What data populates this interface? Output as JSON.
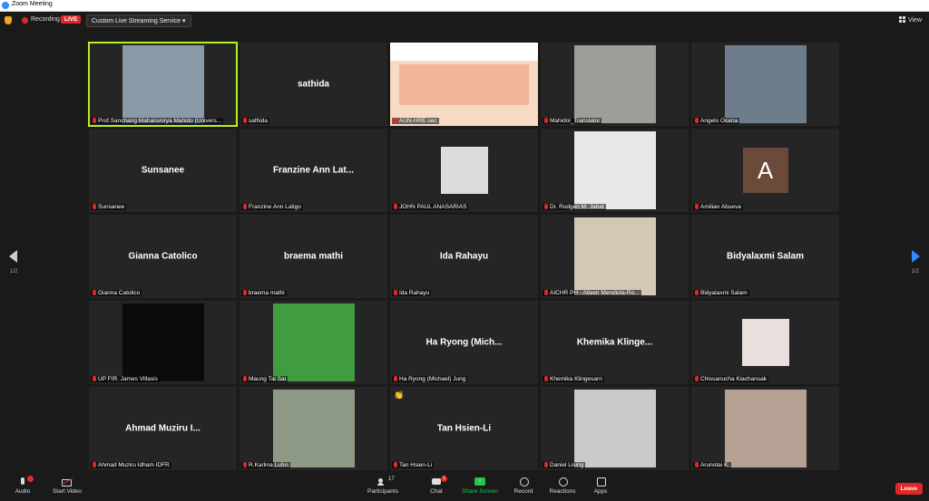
{
  "window": {
    "title": "Zoom Meeting"
  },
  "topbar": {
    "recording": "Recording",
    "live": "LIVE",
    "stream_label": "Custom Live Streaming Service",
    "view": "View"
  },
  "pagination": {
    "left": "1/2",
    "right": "1/2"
  },
  "tiles": [
    {
      "kind": "video",
      "label": "Prof.Sanchang Mahaisvorya Mahido (Univers...",
      "video_color": "#8a9aa8",
      "active": true
    },
    {
      "kind": "name",
      "name": "sathida",
      "label": "sathida"
    },
    {
      "kind": "slide",
      "label": "AUN-HRE.sec"
    },
    {
      "kind": "video",
      "label": "Mahidol_Translator",
      "video_color": "#9c9f98"
    },
    {
      "kind": "video",
      "label": "Angelo Ocena",
      "video_color": "#6d7d8c"
    },
    {
      "kind": "name",
      "name": "Sunsanee",
      "label": "Sunsanee"
    },
    {
      "kind": "name",
      "name": "Franzine Ann Lat...",
      "label": "Franzine Ann Latigo"
    },
    {
      "kind": "video",
      "label": "JOHN PAUL ANASARIAS",
      "video_color": "#dcdcdc",
      "narrow": true
    },
    {
      "kind": "video",
      "label": "Dr. Rodgen M. Jabat",
      "video_color": "#e8e8e8"
    },
    {
      "kind": "avatar",
      "initial": "A",
      "label": "Amilian Abueva"
    },
    {
      "kind": "name",
      "name": "Gianna Catolico",
      "label": "Gianna Catolico"
    },
    {
      "kind": "name",
      "name": "braema mathi",
      "label": "braema mathi"
    },
    {
      "kind": "name",
      "name": "Ida Rahayu",
      "label": "Ida Rahayu"
    },
    {
      "kind": "video",
      "label": "AICHR PH - Aileen Mendiola-Ro...",
      "video_color": "#d4c7b4"
    },
    {
      "kind": "name",
      "name": "Bidyalaxmi Salam",
      "label": "Bidyalaxmi Salam"
    },
    {
      "kind": "video",
      "label": "UP FIR. James Villasis",
      "video_color": "#0b0b0b"
    },
    {
      "kind": "video",
      "label": "Maung Tai Sai",
      "video_color": "#3f9c3f"
    },
    {
      "kind": "name",
      "name": "Ha Ryong (Mich...",
      "label": "Ha Ryong (Michael) Jung"
    },
    {
      "kind": "name",
      "name": "Khemika Klinge...",
      "label": "Khemika Klingesarn"
    },
    {
      "kind": "video",
      "label": "Chissanucha Kiachansak",
      "video_color": "#e9e0de",
      "narrow": true
    },
    {
      "kind": "name",
      "name": "Ahmad Muziru I...",
      "label": "Ahmad Muziru Idham IDFR"
    },
    {
      "kind": "video",
      "label": "R.Karlina Lubis",
      "video_color": "#8f9a86"
    },
    {
      "kind": "name",
      "name": "Tan Hsien-Li",
      "label": "Tan Hsien-Li",
      "hand": "👏"
    },
    {
      "kind": "video",
      "label": "Daniel Lising",
      "video_color": "#c9c9c9"
    },
    {
      "kind": "video",
      "label": "Arunotai K.",
      "video_color": "#b5a294"
    }
  ],
  "toolbar": {
    "audio": "Audio",
    "start_video": "Start Video",
    "participants": "Participants",
    "participants_count": "17",
    "chat": "Chat",
    "chat_badge": "1",
    "share_screen": "Share Screen",
    "record": "Record",
    "reactions": "Reactions",
    "apps": "Apps",
    "leave": "Leave"
  },
  "colors": {
    "accent": "#2d8cff",
    "share": "#23c552",
    "leave": "#e02828",
    "active_speaker": "#b9f01e"
  }
}
